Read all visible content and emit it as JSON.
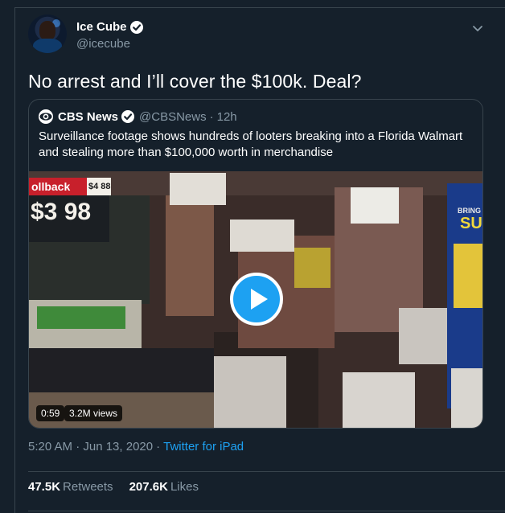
{
  "tweet": {
    "author": {
      "display_name": "Ice Cube",
      "handle": "@icecube",
      "verified_icon": "verified-badge-icon"
    },
    "text": "No arrest and I’ll cover the $100k. Deal?",
    "more_icon": "chevron-down-icon",
    "timestamp": "5:20 AM · Jun 13, 2020",
    "separator": "·",
    "source": "Twitter for iPad",
    "retweets_count": "47.5K",
    "retweets_label": "Retweets",
    "likes_count": "207.6K",
    "likes_label": "Likes"
  },
  "quoted_tweet": {
    "logo_icon": "cbs-eye-logo-icon",
    "display_name": "CBS News",
    "handle": "@CBSNews",
    "dot": "·",
    "time": "12h",
    "text": "Surveillance footage shows hundreds of looters breaking into a Florida Walmart and stealing more than $100,000 worth in merchandise",
    "video": {
      "duration": "0:59",
      "views": "3.2M views",
      "play_icon": "play-icon",
      "signage": {
        "rollback": "ollback",
        "price_small": "$4 88",
        "price_big": "$3 98",
        "display_top": "BRING",
        "display_big": "SU"
      }
    }
  },
  "colors": {
    "background": "#15202b",
    "border": "#38444d",
    "secondary_text": "#8899a6",
    "accent": "#1da1f2",
    "rollback_red": "#c8202b"
  }
}
